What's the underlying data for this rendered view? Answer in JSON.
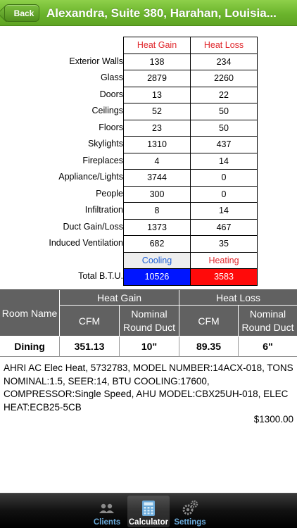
{
  "header": {
    "back_label": "Back",
    "title": "Alexandra, Suite 380, Harahan, Louisia..."
  },
  "btu": {
    "col_gain": "Heat Gain",
    "col_loss": "Heat Loss",
    "rows": [
      {
        "label": "Exterior Walls",
        "gain": "138",
        "loss": "234"
      },
      {
        "label": "Glass",
        "gain": "2879",
        "loss": "2260"
      },
      {
        "label": "Doors",
        "gain": "13",
        "loss": "22"
      },
      {
        "label": "Ceilings",
        "gain": "52",
        "loss": "50"
      },
      {
        "label": "Floors",
        "gain": "23",
        "loss": "50"
      },
      {
        "label": "Skylights",
        "gain": "1310",
        "loss": "437"
      },
      {
        "label": "Fireplaces",
        "gain": "4",
        "loss": "14"
      },
      {
        "label": "Appliance/Lights",
        "gain": "3744",
        "loss": "0"
      },
      {
        "label": "People",
        "gain": "300",
        "loss": "0"
      },
      {
        "label": "Infiltration",
        "gain": "8",
        "loss": "14"
      },
      {
        "label": "Duct Gain/Loss",
        "gain": "1373",
        "loss": "467"
      },
      {
        "label": "Induced Ventilation",
        "gain": "682",
        "loss": "35"
      }
    ],
    "cooling_label": "Cooling",
    "heating_label": "Heating",
    "total_label": "Total B.T.U.",
    "total_cooling": "10526",
    "total_heating": "3583",
    "colors": {
      "header_text": "#e0262b",
      "cooling_text": "#1d5fd6",
      "cooling_total_bg": "#0015ff",
      "heating_total_bg": "#ff0a0a"
    }
  },
  "room": {
    "room_name_header": "Room Name",
    "heat_gain_header": "Heat Gain",
    "heat_loss_header": "Heat Loss",
    "cfm_header": "CFM",
    "nominal_header": "Nominal",
    "round_duct_header": "Round Duct",
    "row": {
      "name": "Dining",
      "gain_cfm": "351.13",
      "gain_duct": "10\"",
      "loss_cfm": "89.35",
      "loss_duct": "6\""
    }
  },
  "equipment": {
    "description": "AHRI AC Elec Heat, 5732783, MODEL NUMBER:14ACX-018, TONS NOMINAL:1.5, SEER:14, BTU COOLING:17600, COMPRESSOR:Single Speed, AHU MODEL:CBX25UH-018, ELEC HEAT:ECB25-5CB",
    "price": "$1300.00"
  },
  "tabs": [
    {
      "label": "Clients",
      "icon": "people-icon",
      "active": false
    },
    {
      "label": "Calculator",
      "icon": "calculator-icon",
      "active": true
    },
    {
      "label": "Settings",
      "icon": "gears-icon",
      "active": false
    }
  ],
  "brand_color": "#6bb42c"
}
